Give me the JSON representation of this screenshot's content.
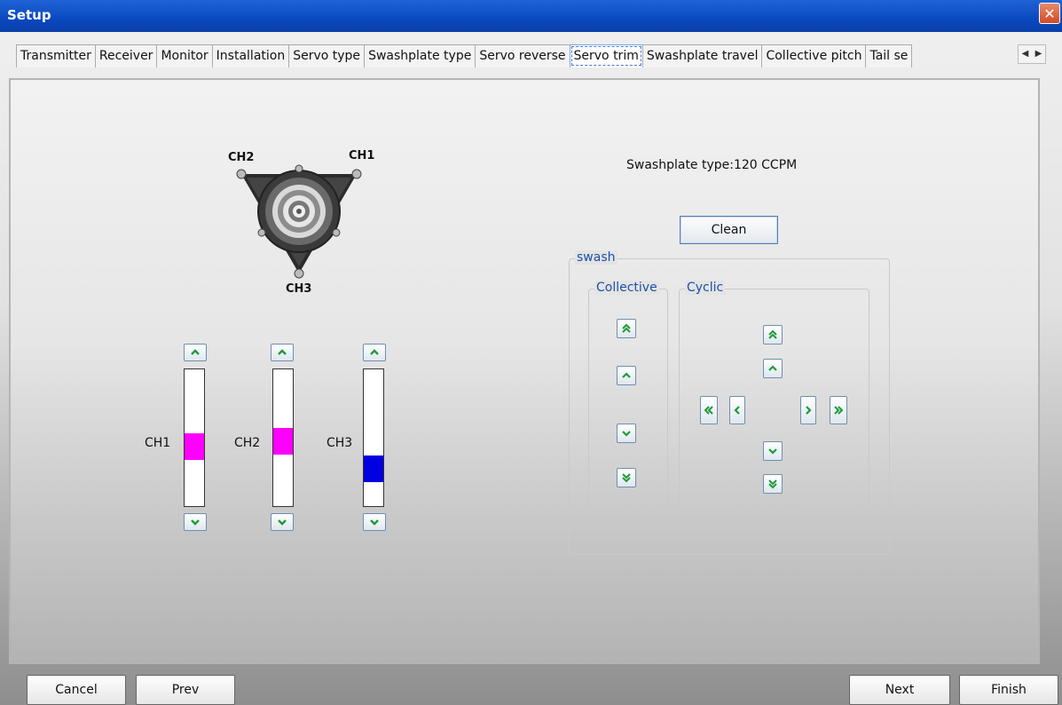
{
  "window": {
    "title": "Setup"
  },
  "tabs": [
    {
      "label": "Transmitter"
    },
    {
      "label": "Receiver"
    },
    {
      "label": "Monitor"
    },
    {
      "label": "Installation"
    },
    {
      "label": "Servo type"
    },
    {
      "label": "Swashplate type"
    },
    {
      "label": "Servo reverse"
    },
    {
      "label": "Servo trim",
      "active": true
    },
    {
      "label": "Swashplate travel"
    },
    {
      "label": "Collective pitch"
    },
    {
      "label": "Tail se"
    }
  ],
  "diagram": {
    "ch1": "CH1",
    "ch2": "CH2",
    "ch3": "CH3"
  },
  "sliders": [
    {
      "label": "CH1",
      "color": "#ff00ff",
      "value": 0.42
    },
    {
      "label": "CH2",
      "color": "#ff00ff",
      "value": 0.47
    },
    {
      "label": "CH3",
      "color": "#0000e0",
      "value": 0.22
    }
  ],
  "right": {
    "swash_type": "Swashplate type:120 CCPM",
    "clean": "Clean",
    "swash_group": "swash",
    "collective_group": "Collective",
    "cyclic_group": "Cyclic"
  },
  "buttons": {
    "cancel": "Cancel",
    "prev": "Prev",
    "next": "Next",
    "finish": "Finish"
  },
  "colors": {
    "titlebar": "#0a49c0",
    "group_title": "#1c4ea8",
    "arrow": "#1e9a3a"
  }
}
